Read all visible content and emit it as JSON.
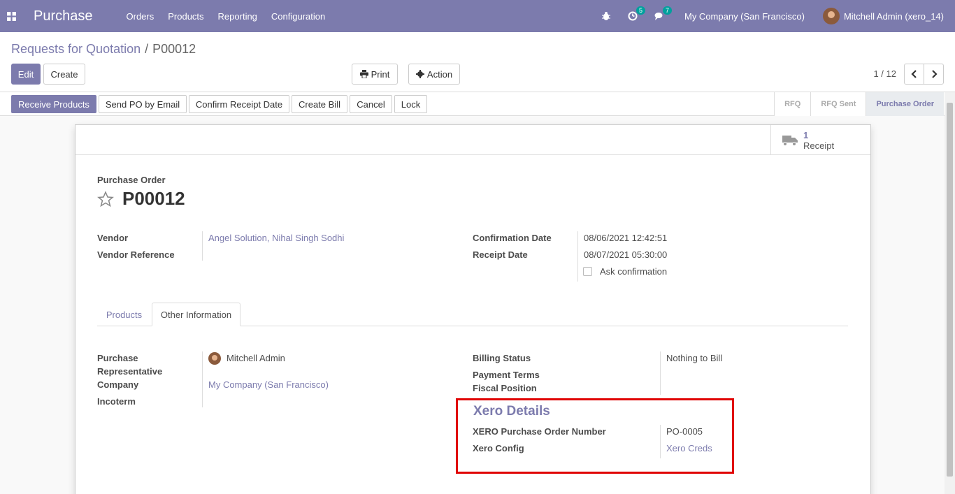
{
  "navbar": {
    "app_title": "Purchase",
    "menu": [
      "Orders",
      "Products",
      "Reporting",
      "Configuration"
    ],
    "activity_badge": "5",
    "messages_badge": "7",
    "company": "My Company (San Francisco)",
    "user": "Mitchell Admin (xero_14)"
  },
  "breadcrumb": {
    "parent": "Requests for Quotation",
    "separator": "/",
    "current": "P00012"
  },
  "toolbar": {
    "edit": "Edit",
    "create": "Create",
    "print": "Print",
    "action": "Action",
    "pager": "1 / 12"
  },
  "statusbar": {
    "buttons": [
      "Receive Products",
      "Send PO by Email",
      "Confirm Receipt Date",
      "Create Bill",
      "Cancel",
      "Lock"
    ],
    "stages": [
      "RFQ",
      "RFQ Sent",
      "Purchase Order"
    ],
    "active_stage": "Purchase Order"
  },
  "smart_button": {
    "count": "1",
    "label": "Receipt"
  },
  "form": {
    "title_label": "Purchase Order",
    "name": "P00012",
    "vendor_label": "Vendor",
    "vendor_value": "Angel Solution, Nihal Singh Sodhi",
    "vendor_ref_label": "Vendor Reference",
    "confirmation_date_label": "Confirmation Date",
    "confirmation_date_value": "08/06/2021 12:42:51",
    "receipt_date_label": "Receipt Date",
    "receipt_date_value": "08/07/2021 05:30:00",
    "ask_confirmation_label": "Ask confirmation"
  },
  "tabs": [
    "Products",
    "Other Information"
  ],
  "other_info": {
    "purchase_rep_label_1": "Purchase",
    "purchase_rep_label_2": "Representative",
    "purchase_rep_value": "Mitchell Admin",
    "company_label": "Company",
    "company_value": "My Company (San Francisco)",
    "incoterm_label": "Incoterm",
    "billing_status_label": "Billing Status",
    "billing_status_value": "Nothing to Bill",
    "payment_terms_label": "Payment Terms",
    "fiscal_position_label": "Fiscal Position"
  },
  "xero": {
    "title": "Xero Details",
    "po_number_label": "XERO Purchase Order Number",
    "po_number_value": "PO-0005",
    "config_label": "Xero Config",
    "config_value": "Xero Creds"
  },
  "colors": {
    "brand": "#7c7bad",
    "highlight": "#e00000",
    "badge": "#00a09d"
  }
}
